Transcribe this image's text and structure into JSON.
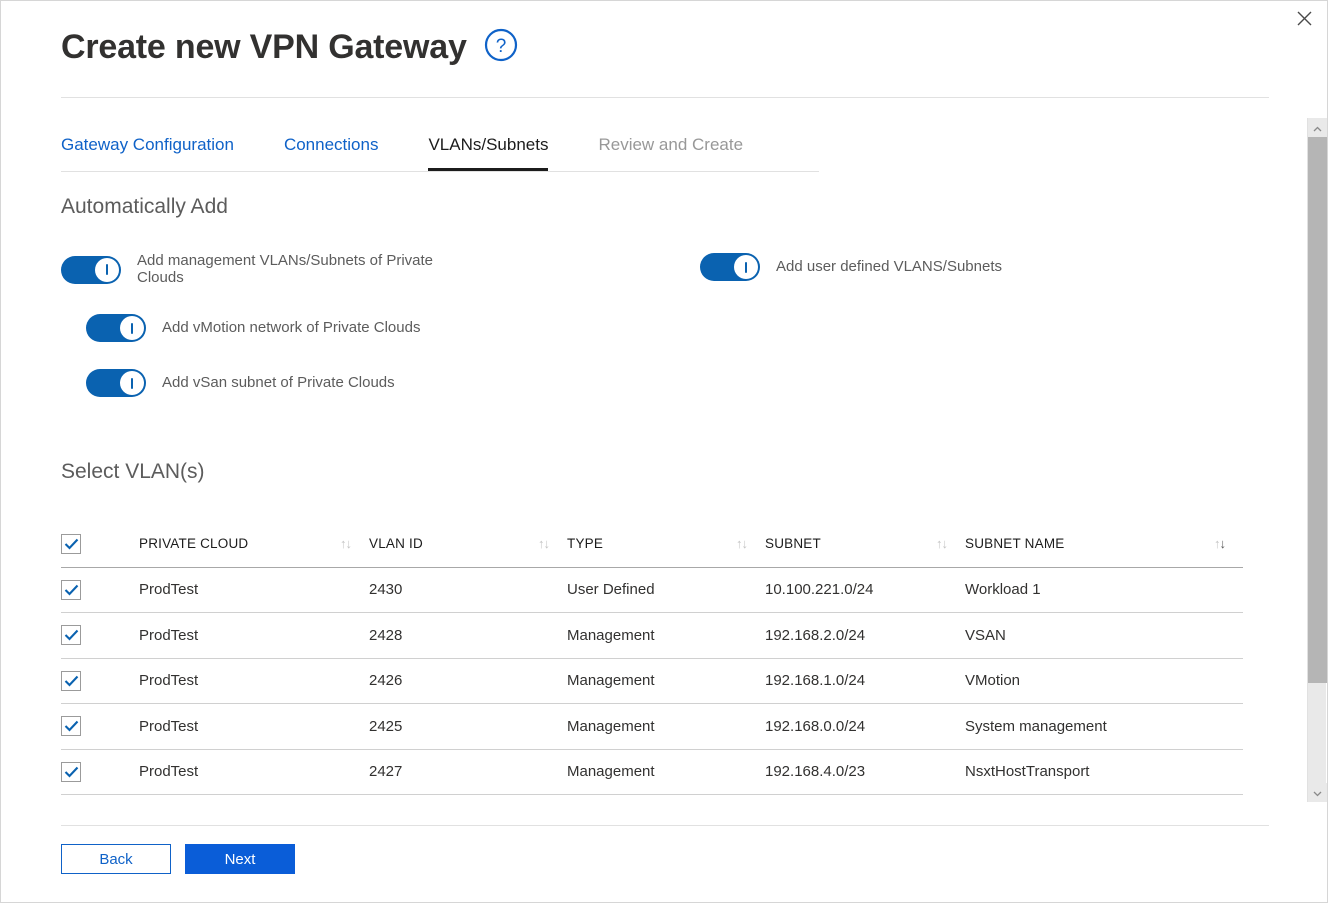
{
  "window": {
    "close_label": "×",
    "close_icon": "close-icon"
  },
  "header": {
    "title": "Create new VPN Gateway",
    "help_icon": "help-circle-icon",
    "help_label": "?"
  },
  "tabs": [
    {
      "label": "Gateway Configuration",
      "state": "link"
    },
    {
      "label": "Connections",
      "state": "link"
    },
    {
      "label": "VLANs/Subnets",
      "state": "active"
    },
    {
      "label": "Review and Create",
      "state": "disabled"
    }
  ],
  "auto_add": {
    "heading": "Automatically Add",
    "toggles": [
      {
        "id": "mgmt",
        "label": "Add management VLANs/Subnets of Private Clouds",
        "on": true
      },
      {
        "id": "user",
        "label": "Add user defined VLANS/Subnets",
        "on": true
      },
      {
        "id": "vmotion",
        "label": "Add vMotion network of Private Clouds",
        "on": true
      },
      {
        "id": "vsan",
        "label": "Add vSan subnet of Private Clouds",
        "on": true
      }
    ]
  },
  "select_vlans": {
    "heading": "Select VLAN(s)",
    "header_checkbox_checked": true,
    "columns": [
      {
        "key": "private_cloud",
        "label": "PRIVATE CLOUD",
        "sortable": true,
        "sort_state": "none"
      },
      {
        "key": "vlan_id",
        "label": "VLAN ID",
        "sortable": true,
        "sort_state": "none"
      },
      {
        "key": "type",
        "label": "TYPE",
        "sortable": true,
        "sort_state": "none"
      },
      {
        "key": "subnet",
        "label": "SUBNET",
        "sortable": true,
        "sort_state": "none"
      },
      {
        "key": "subnet_name",
        "label": "SUBNET NAME",
        "sortable": true,
        "sort_state": "desc"
      }
    ],
    "rows": [
      {
        "checked": true,
        "private_cloud": "ProdTest",
        "vlan_id": "2430",
        "type": "User Defined",
        "subnet": "10.100.221.0/24",
        "subnet_name": "Workload 1"
      },
      {
        "checked": true,
        "private_cloud": "ProdTest",
        "vlan_id": "2428",
        "type": "Management",
        "subnet": "192.168.2.0/24",
        "subnet_name": "VSAN"
      },
      {
        "checked": true,
        "private_cloud": "ProdTest",
        "vlan_id": "2426",
        "type": "Management",
        "subnet": "192.168.1.0/24",
        "subnet_name": "VMotion"
      },
      {
        "checked": true,
        "private_cloud": "ProdTest",
        "vlan_id": "2425",
        "type": "Management",
        "subnet": "192.168.0.0/24",
        "subnet_name": "System management"
      },
      {
        "checked": true,
        "private_cloud": "ProdTest",
        "vlan_id": "2427",
        "type": "Management",
        "subnet": "192.168.4.0/23",
        "subnet_name": "NsxtHostTransport"
      }
    ],
    "partial_row": {
      "checked": true
    }
  },
  "scrollbar": {
    "up_icon": "chevron-up-icon",
    "down_icon": "chevron-down-icon"
  },
  "footer": {
    "back_label": "Back",
    "next_label": "Next"
  },
  "colors": {
    "accent_blue": "#0f62c8",
    "primary_button": "#0a5dd8",
    "toggle_on": "#0a62b0",
    "checkbox_check": "#0a62b0",
    "active_tab_underline": "#1c1c1c",
    "disabled_text": "#989898",
    "heading_gray": "#5c5c5c"
  }
}
